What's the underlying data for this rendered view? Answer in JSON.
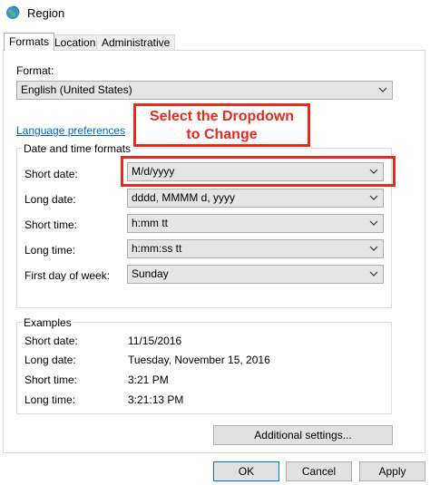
{
  "window": {
    "title": "Region"
  },
  "tabs": [
    {
      "label": "Formats"
    },
    {
      "label": "Location"
    },
    {
      "label": "Administrative"
    }
  ],
  "format": {
    "label": "Format:",
    "value": "English (United States)"
  },
  "language_link": "Language preferences",
  "date_time_group": {
    "title": "Date and time formats",
    "rows": [
      {
        "label": "Short date:",
        "value": "M/d/yyyy"
      },
      {
        "label": "Long date:",
        "value": "dddd, MMMM d, yyyy"
      },
      {
        "label": "Short time:",
        "value": "h:mm tt"
      },
      {
        "label": "Long time:",
        "value": "h:mm:ss tt"
      },
      {
        "label": "First day of week:",
        "value": "Sunday"
      }
    ]
  },
  "examples": {
    "title": "Examples",
    "rows": [
      {
        "label": "Short date:",
        "value": "11/15/2016"
      },
      {
        "label": "Long date:",
        "value": "Tuesday, November 15, 2016"
      },
      {
        "label": "Short time:",
        "value": "3:21 PM"
      },
      {
        "label": "Long time:",
        "value": "3:21:13 PM"
      }
    ]
  },
  "buttons": {
    "additional": "Additional settings...",
    "ok": "OK",
    "cancel": "Cancel",
    "apply": "Apply"
  },
  "annotation": {
    "line1": "Select the Dropdown",
    "line2": "to Change"
  },
  "colors": {
    "annotation": "#e32b20",
    "link": "#0066cc",
    "focus": "#0078d7"
  }
}
